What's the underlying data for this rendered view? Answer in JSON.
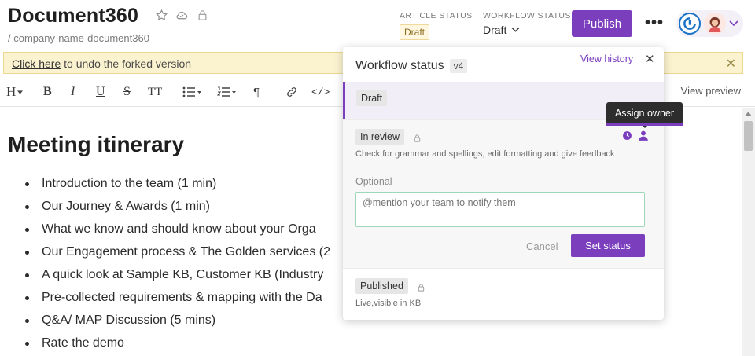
{
  "header": {
    "title": "Document360",
    "breadcrumb": "/ company-name-document360",
    "article_status_label": "ARTICLE STATUS",
    "article_status_value": "Draft",
    "workflow_status_label": "WORKFLOW STATUS",
    "workflow_status_value": "Draft",
    "publish_label": "Publish",
    "more_label": "•••"
  },
  "banner": {
    "link_text": "Click here",
    "text": " to undo the forked version",
    "close": "✕"
  },
  "toolbar": {
    "heading": "H",
    "bold": "B",
    "italic": "I",
    "underline": "U",
    "strike": "S",
    "text_size": "TT",
    "paragraph": "¶",
    "code": "</>",
    "view_preview": "View preview"
  },
  "editor": {
    "heading": "Meeting itinerary",
    "items": [
      "Introduction to the team (1 min)",
      "Our Journey & Awards (1 min)",
      "What we know and should know about your Orga",
      "Our Engagement process & The Golden services (2",
      "A quick look at Sample KB, Customer KB (Industry",
      "Pre-collected requirements & mapping with the Da",
      "Q&A/ MAP Discussion (5 mins)",
      "Rate the demo"
    ]
  },
  "popover": {
    "title": "Workflow status",
    "version": "v4",
    "view_history": "View history",
    "close": "✕",
    "steps": {
      "draft": {
        "label": "Draft"
      },
      "review": {
        "label": "In review",
        "description": "Check for grammar and spellings, edit formatting and give feedback",
        "optional_label": "Optional",
        "mention_placeholder": "@mention your team to notify them",
        "cancel_label": "Cancel",
        "set_status_label": "Set status"
      },
      "published": {
        "label": "Published",
        "description": "Live,visible in KB"
      }
    }
  },
  "tooltip": {
    "text": "Assign owner"
  },
  "colors": {
    "accent": "#7b3fbe",
    "banner": "#fbf3cf"
  }
}
